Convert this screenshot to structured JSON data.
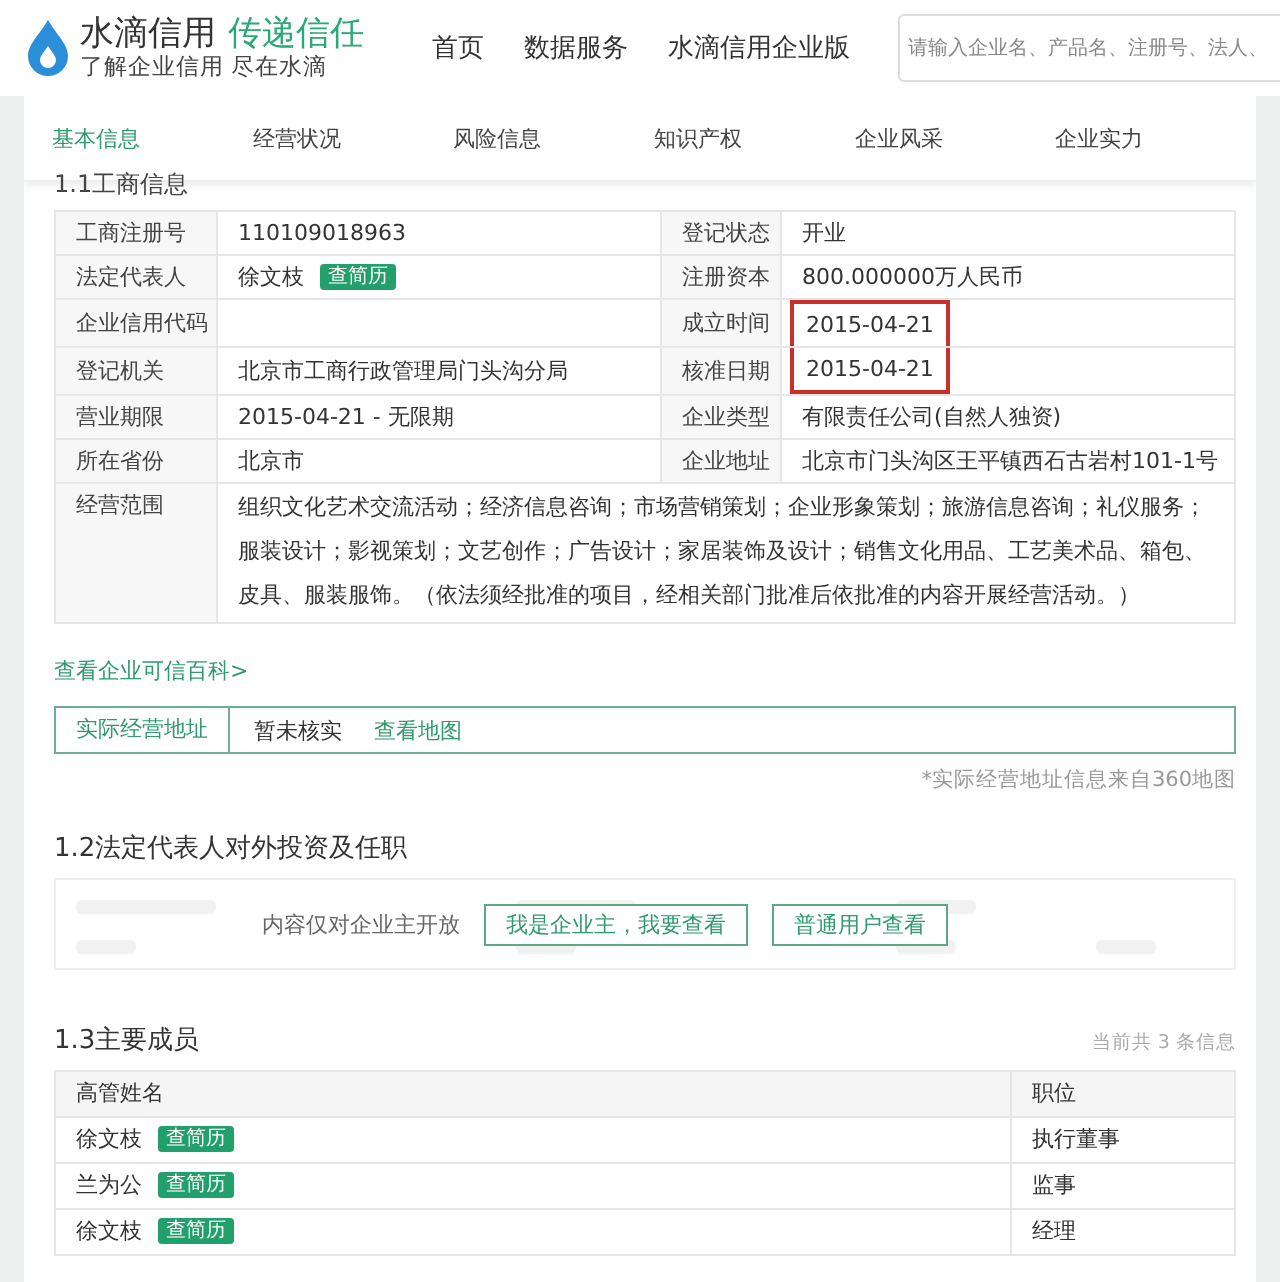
{
  "header": {
    "brand": "水滴信用",
    "slogan": "传递信任",
    "tagline": "了解企业信用 尽在水滴",
    "nav": [
      "首页",
      "数据服务",
      "水滴信用企业版"
    ],
    "search": {
      "placeholder": "请输入企业名、产品名、注册号、法人、"
    }
  },
  "tabs": [
    {
      "label": "基本信息",
      "selected": true
    },
    {
      "label": "经营状况",
      "selected": false
    },
    {
      "label": "风险信息",
      "selected": false
    },
    {
      "label": "知识产权",
      "selected": false
    },
    {
      "label": "企业风采",
      "selected": false
    },
    {
      "label": "企业实力",
      "selected": false
    }
  ],
  "section_1": {
    "title": "1.1工商信息",
    "rows": [
      {
        "label": "工商注册号",
        "value": "110109018963",
        "badge": "",
        "label_2": "登记状态",
        "value_2": "开业",
        "highlighted": false
      },
      {
        "label": "法定代表人",
        "value": "徐文枝",
        "badge": "查简历",
        "label_2": "注册资本",
        "value_2": "800.000000万人民币",
        "highlighted": false
      },
      {
        "label": "企业信用代码",
        "value": "",
        "badge": "",
        "label_2": "成立时间",
        "value_2": "2015-04-21",
        "highlighted": true
      },
      {
        "label": "登记机关",
        "value": "北京市工商行政管理局门头沟分局",
        "badge": "",
        "label_2": "核准日期",
        "value_2": "2015-04-21",
        "highlighted": true
      },
      {
        "label": "营业期限",
        "value": "2015-04-21 - 无限期",
        "badge": "",
        "label_2": "企业类型",
        "value_2": "有限责任公司(自然人独资)",
        "highlighted": false
      },
      {
        "label": "所在省份",
        "value": "北京市",
        "badge": "",
        "label_2": "企业地址",
        "value_2": "北京市门头沟区王平镇西石古岩村101-1号",
        "highlighted": false
      }
    ],
    "scope": {
      "label": "经营范围",
      "value": "组织文化艺术交流活动；经济信息咨询；市场营销策划；企业形象策划；旅游信息咨询；礼仪服务；服装设计；影视策划；文艺创作；广告设计；家居装饰及设计；销售文化用品、工艺美术品、箱包、皮具、服装服饰。（依法须经批准的项目，经相关部门批准后依批准的内容开展经营活动。）"
    },
    "wiki_link": "查看企业可信百科>",
    "address": {
      "label": "实际经营地址",
      "status": "暂未核实",
      "map_link": "查看地图",
      "note": "*实际经营地址信息来自360地图"
    }
  },
  "section_2": {
    "title": "1.2法定代表人对外投资及任职",
    "message": "内容仅对企业主开放",
    "buttons": [
      "我是企业主，我要查看",
      "普通用户查看"
    ]
  },
  "section_3": {
    "title": "1.3主要成员",
    "count": "当前共 3 条信息",
    "columns": [
      "高管姓名",
      "职位"
    ],
    "rows": [
      {
        "name": "徐文枝",
        "badge": "查简历",
        "position": "执行董事"
      },
      {
        "name": "兰为公",
        "badge": "查简历",
        "position": "监事"
      },
      {
        "name": "徐文枝",
        "badge": "查简历",
        "position": "经理"
      }
    ]
  }
}
